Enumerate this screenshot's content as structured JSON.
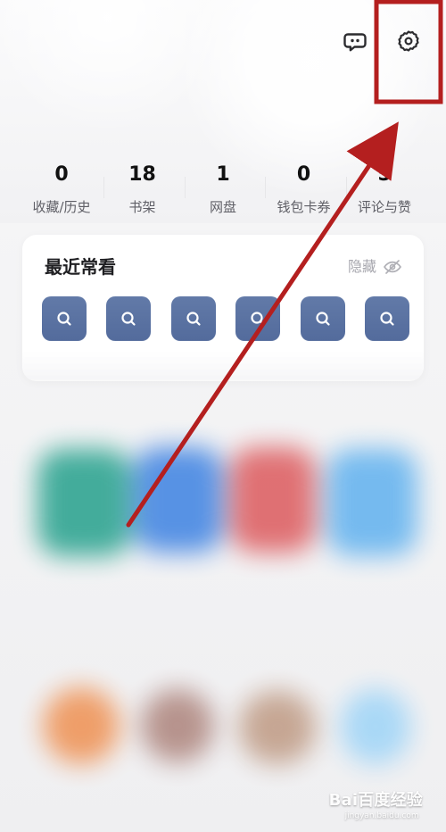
{
  "colors": {
    "background": "#f3f3f5",
    "card": "#ffffff",
    "primary_text": "#111111",
    "secondary_text": "#5f5f66",
    "muted_text": "#a6a6ad",
    "recent_icon": "#5a72a3",
    "annotation_red": "#b41f1f"
  },
  "header": {
    "message_icon": "chat-bubble-icon",
    "settings_icon": "gear-icon"
  },
  "stats": [
    {
      "value": "0",
      "label": "收藏/历史"
    },
    {
      "value": "18",
      "label": "书架"
    },
    {
      "value": "1",
      "label": "网盘"
    },
    {
      "value": "0",
      "label": "钱包卡券"
    },
    {
      "value": "5",
      "label": "评论与赞"
    }
  ],
  "recent": {
    "title": "最近常看",
    "hide_label": "隐藏",
    "hide_icon": "eye-off-icon",
    "tiles": [
      {
        "icon": "search-icon"
      },
      {
        "icon": "search-icon"
      },
      {
        "icon": "search-icon"
      },
      {
        "icon": "search-icon"
      },
      {
        "icon": "search-icon"
      },
      {
        "icon": "search-icon"
      }
    ]
  },
  "watermark": {
    "main": "Bai百度经验",
    "sub": "jingyan.baidu.com"
  },
  "annotation": {
    "highlight": "settings-highlight-box",
    "arrow": "annotation-arrow"
  }
}
